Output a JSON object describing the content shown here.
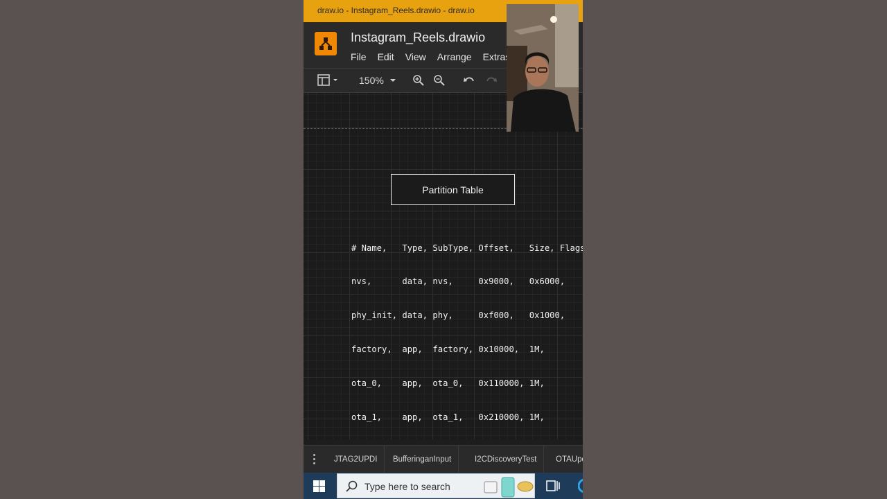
{
  "window": {
    "title": "draw.io - Instagram_Reels.drawio - draw.io"
  },
  "header": {
    "filename": "Instagram_Reels.drawio",
    "menu": [
      "File",
      "Edit",
      "View",
      "Arrange",
      "Extras"
    ]
  },
  "toolbar": {
    "zoom": "150%"
  },
  "canvas": {
    "box_label": "Partition Table",
    "code_lines": [
      "# Name,   Type, SubType, Offset,   Size, Flags",
      "nvs,      data, nvs,     0x9000,   0x6000,",
      "phy_init, data, phy,     0xf000,   0x1000,",
      "factory,  app,  factory, 0x10000,  1M,",
      "ota_0,    app,  ota_0,   0x110000, 1M,",
      "ota_1,    app,  ota_1,   0x210000, 1M,"
    ]
  },
  "tabs": [
    "JTAG2UPDI",
    "BufferinganInput",
    "I2CDiscoveryTest",
    "OTAUpd"
  ],
  "taskbar": {
    "search_placeholder": "Type here to search"
  },
  "colors": {
    "titlebar": "#e8a10f",
    "logo": "#f08705",
    "taskbar": "#1f3b5a"
  },
  "icons": [
    "drawio-logo-icon",
    "format-panel-icon",
    "zoom-in-icon",
    "zoom-out-icon",
    "undo-icon",
    "redo-icon",
    "windows-start-icon",
    "search-icon"
  ]
}
